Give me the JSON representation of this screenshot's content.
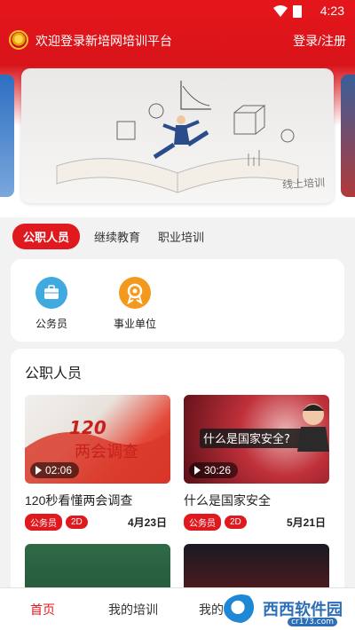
{
  "status": {
    "time": "4:23"
  },
  "header": {
    "welcome": "欢迎登录新培网培训平台",
    "login": "登录/注册"
  },
  "banner": {
    "caption": "线上培训"
  },
  "tabs": [
    {
      "label": "公职人员",
      "active": true
    },
    {
      "label": "继续教育",
      "active": false
    },
    {
      "label": "职业培训",
      "active": false
    }
  ],
  "categories": [
    {
      "label": "公务员",
      "icon": "briefcase-icon",
      "color": "#3fa9e0"
    },
    {
      "label": "事业单位",
      "icon": "badge-icon",
      "color": "#f39a1e"
    }
  ],
  "section": {
    "title": "公职人员"
  },
  "videos": [
    {
      "title": "120秒看懂两会调查",
      "duration": "02:06",
      "tags": [
        "公务员",
        "2D"
      ],
      "date": "4月23日",
      "thumb_text": "两会调查"
    },
    {
      "title": "什么是国家安全",
      "duration": "30:26",
      "tags": [
        "公务员",
        "2D"
      ],
      "date": "5月21日",
      "thumb_text": "什么是国家安全?"
    }
  ],
  "bottom_nav": [
    {
      "label": "首页",
      "active": true
    },
    {
      "label": "我的培训",
      "active": false
    },
    {
      "label": "我的",
      "active": false
    }
  ],
  "watermark": {
    "text": "西西软件园",
    "url": "cr173.com"
  },
  "colors": {
    "primary": "#e0191e"
  }
}
